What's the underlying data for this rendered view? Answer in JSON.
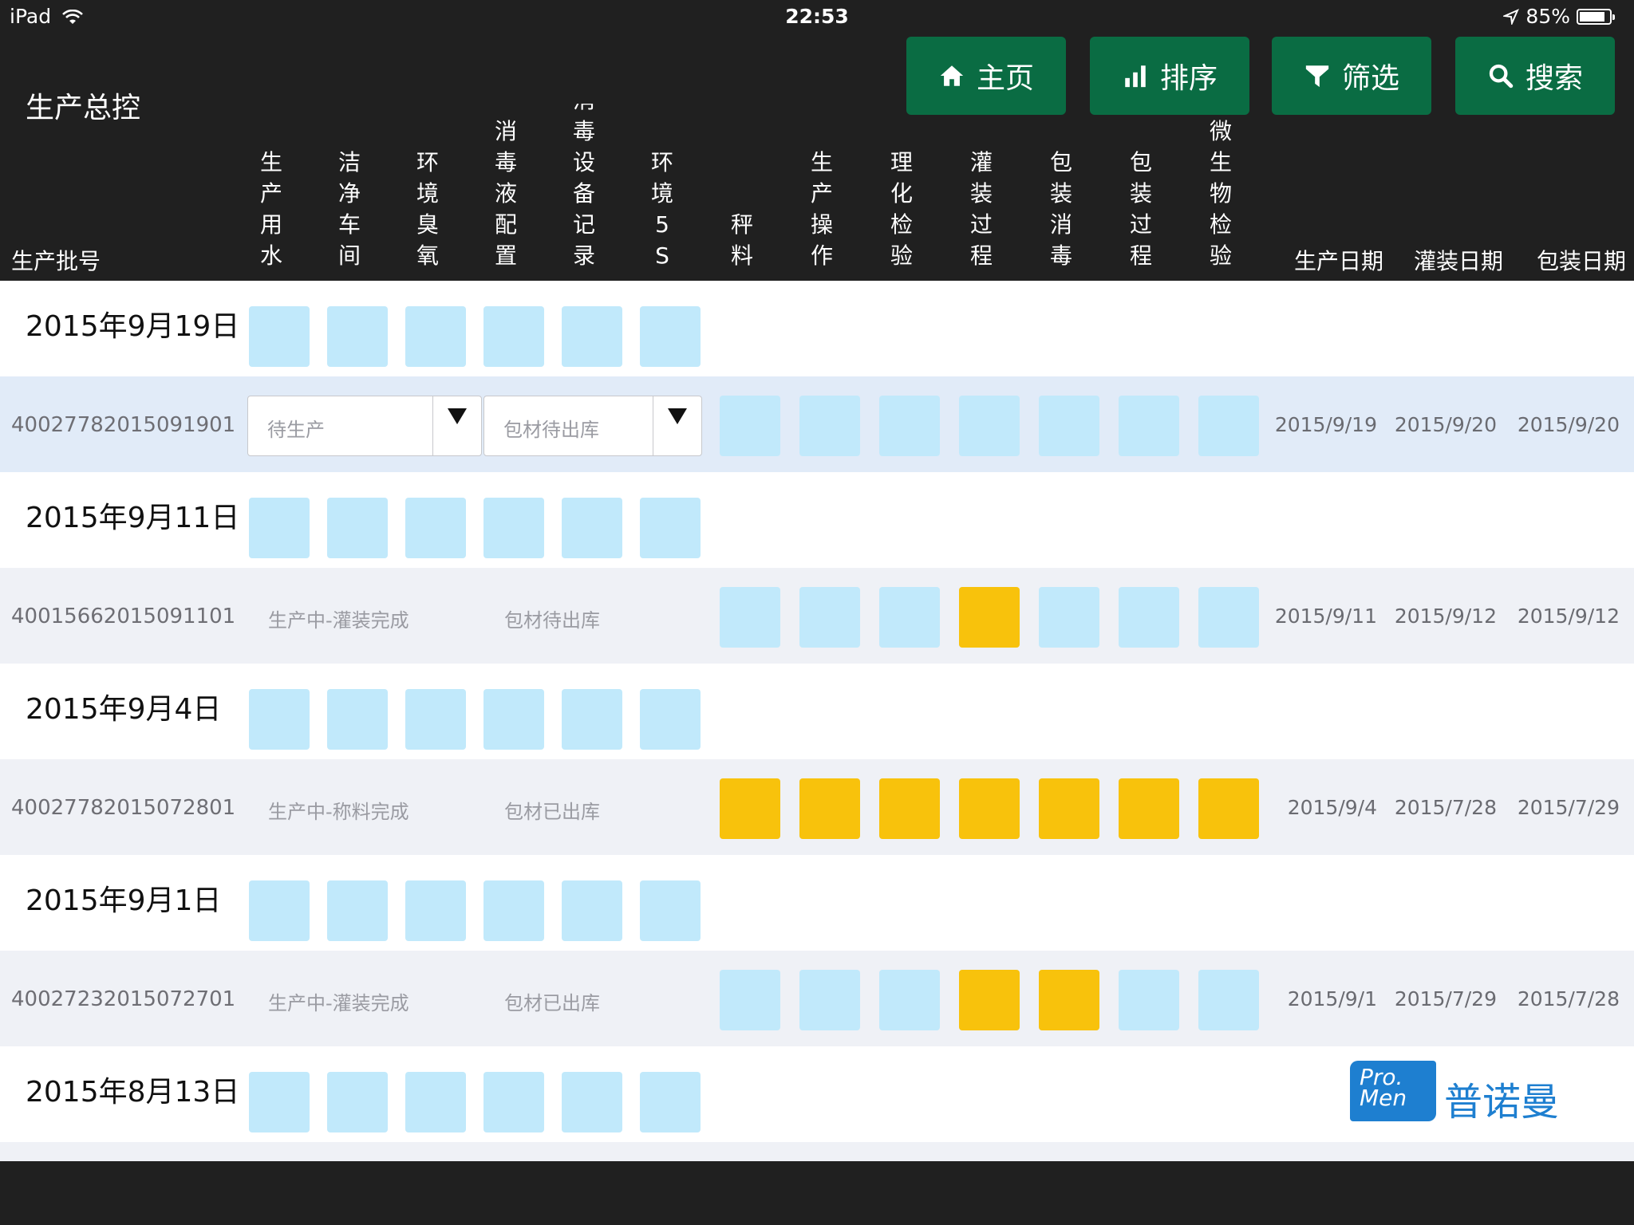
{
  "status_bar": {
    "device": "iPad",
    "time": "22:53",
    "battery_text": "85%",
    "battery_level": 0.85
  },
  "app": {
    "title": "生产总控"
  },
  "toolbar": [
    {
      "label": "主页",
      "icon": "home-icon"
    },
    {
      "label": "排序",
      "icon": "bar-chart-icon"
    },
    {
      "label": "筛选",
      "icon": "filter-icon"
    },
    {
      "label": "搜索",
      "icon": "search-icon"
    }
  ],
  "header": {
    "batch_col": "生产批号",
    "step_cols": [
      "生产用水",
      "洁净车间",
      "环境臭氧",
      "消毒液配置",
      "消毒设备记录",
      "环境5S",
      "秤料",
      "生产操作",
      "理化检验",
      "灌装过程",
      "包装消毒",
      "包装过程",
      "微生物检验"
    ],
    "date_cols": [
      "生产日期",
      "灌装日期",
      "包装日期"
    ]
  },
  "colors": {
    "blue_cell": "#c1e9fb",
    "yellow_cell": "#f8c20c",
    "button_green": "#0a6c43"
  },
  "groups": [
    {
      "date": "2015年9月19日",
      "env": [
        "blue",
        "blue",
        "blue",
        "blue",
        "blue",
        "blue"
      ],
      "batch": {
        "id": "40027782015091901",
        "status": "待生产",
        "material": "包材待出库",
        "editable": true,
        "steps": [
          "blue",
          "blue",
          "blue",
          "blue",
          "blue",
          "blue",
          "blue"
        ],
        "dates": [
          "2015/9/19",
          "2015/9/20",
          "2015/9/20"
        ]
      }
    },
    {
      "date": "2015年9月11日",
      "env": [
        "blue",
        "blue",
        "blue",
        "blue",
        "blue",
        "blue"
      ],
      "batch": {
        "id": "40015662015091101",
        "status": "生产中-灌装完成",
        "material": "包材待出库",
        "editable": false,
        "steps": [
          "blue",
          "blue",
          "blue",
          "yellow",
          "blue",
          "blue",
          "blue"
        ],
        "dates": [
          "2015/9/11",
          "2015/9/12",
          "2015/9/12"
        ]
      }
    },
    {
      "date": "2015年9月4日",
      "env": [
        "blue",
        "blue",
        "blue",
        "blue",
        "blue",
        "blue"
      ],
      "batch": {
        "id": "40027782015072801",
        "status": "生产中-称料完成",
        "material": "包材已出库",
        "editable": false,
        "steps": [
          "yellow",
          "yellow",
          "yellow",
          "yellow",
          "yellow",
          "yellow",
          "yellow"
        ],
        "dates": [
          "2015/9/4",
          "2015/7/28",
          "2015/7/29"
        ]
      }
    },
    {
      "date": "2015年9月1日",
      "env": [
        "blue",
        "blue",
        "blue",
        "blue",
        "blue",
        "blue"
      ],
      "batch": {
        "id": "40027232015072701",
        "status": "生产中-灌装完成",
        "material": "包材已出库",
        "editable": false,
        "steps": [
          "blue",
          "blue",
          "blue",
          "yellow",
          "yellow",
          "blue",
          "blue"
        ],
        "dates": [
          "2015/9/1",
          "2015/7/29",
          "2015/7/28"
        ]
      }
    },
    {
      "date": "2015年8月13日",
      "env": [
        "blue",
        "blue",
        "blue",
        "blue",
        "blue",
        "blue"
      ]
    }
  ],
  "logo": {
    "mark_line1": "Pro.",
    "mark_line2": "Men",
    "name": "普诺曼"
  }
}
